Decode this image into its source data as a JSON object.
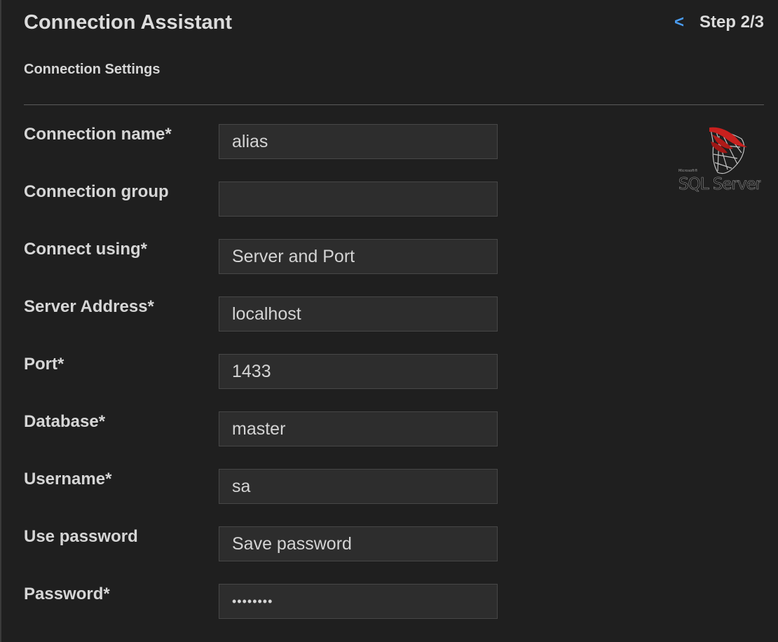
{
  "header": {
    "title": "Connection Assistant",
    "back_label": "<",
    "step": "Step 2/3"
  },
  "section": {
    "title": "Connection Settings"
  },
  "logo": {
    "icon": "sql-server-logo",
    "brand_small": "Microsoft®",
    "brand_text": "SQL Server"
  },
  "form": {
    "fields": [
      {
        "label": "Connection name*",
        "value": "alias"
      },
      {
        "label": "Connection group",
        "value": ""
      },
      {
        "label": "Connect using*",
        "value": "Server and Port"
      },
      {
        "label": "Server Address*",
        "value": "localhost"
      },
      {
        "label": "Port*",
        "value": "1433"
      },
      {
        "label": "Database*",
        "value": "master"
      },
      {
        "label": "Username*",
        "value": "sa"
      },
      {
        "label": "Use password",
        "value": "Save password"
      },
      {
        "label": "Password*",
        "value": "••••••••"
      }
    ]
  },
  "colors": {
    "background": "#1f1f1f",
    "input_background": "#2d2d2d",
    "accent": "#4a9cf0",
    "logo_red": "#c8201e"
  }
}
